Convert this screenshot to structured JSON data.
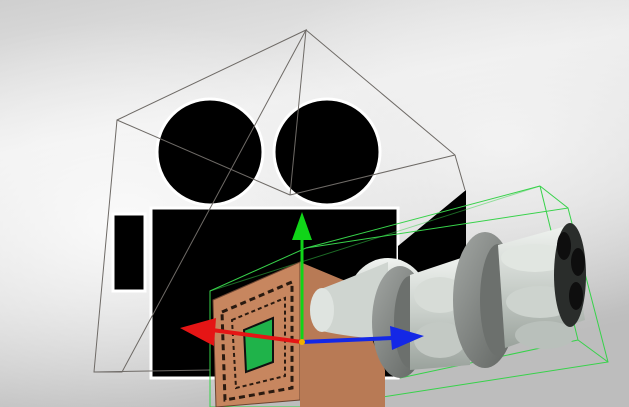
{
  "scene": {
    "sky_colors": [
      "#f2f2f2",
      "#d6d6d6",
      "#b4b4b4"
    ],
    "camera_icon_color": "#000000",
    "camera_icon_outline": "#ffffff",
    "wireframe_color": "#6e6a66",
    "selection_box_color": "#37d24a",
    "object_name": "camera"
  },
  "gizmo": {
    "x_axis_color": "#e51515",
    "y_axis_color": "#10d418",
    "z_axis_color": "#1428e6",
    "center_color": "#f0b000"
  },
  "model": {
    "cube_color": "#c7865f",
    "cube_side_color": "#b87a55",
    "inner_panel_color": "#1fb34a",
    "lens_light": "#d7dcd7",
    "lens_mid": "#b9c0bb",
    "ring_color": "#8a8e8b",
    "ring_dark": "#6c706d",
    "hole_color": "#0e0e0e"
  }
}
